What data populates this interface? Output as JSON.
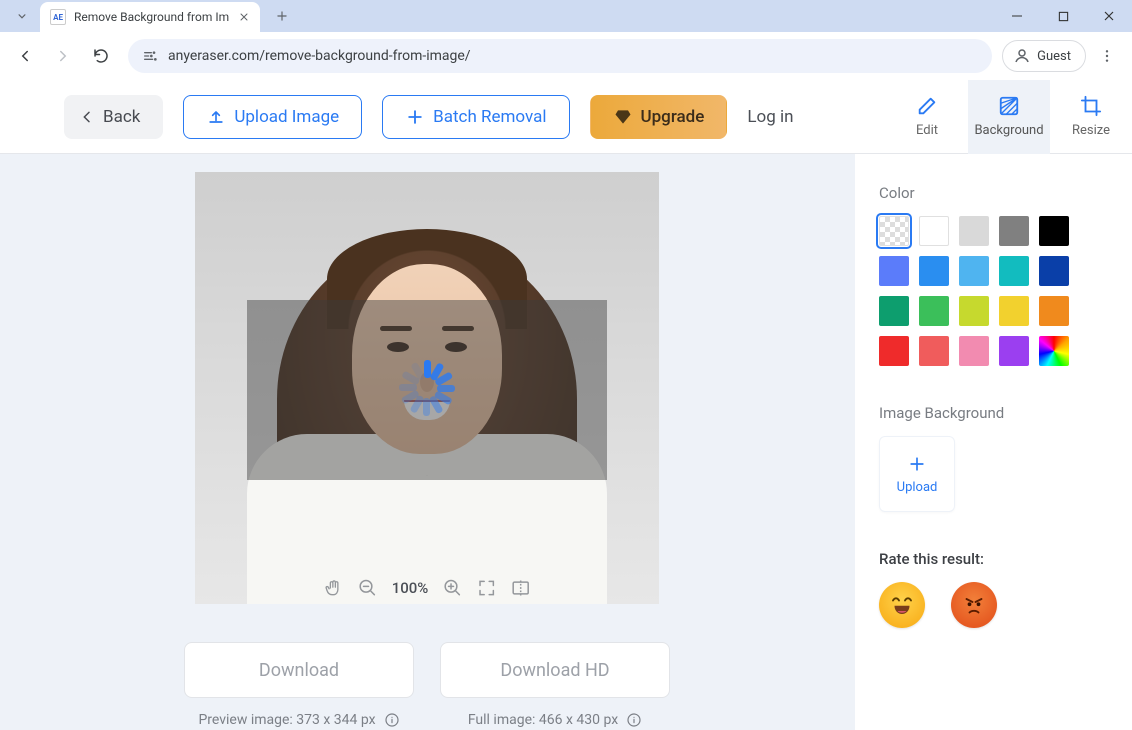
{
  "browser": {
    "tab_title": "Remove Background from Im",
    "url": "anyeraser.com/remove-background-from-image/",
    "guest_label": "Guest",
    "favicon_text": "AE"
  },
  "toolbar": {
    "back": "Back",
    "upload": "Upload Image",
    "batch": "Batch Removal",
    "upgrade": "Upgrade",
    "login": "Log in",
    "tabs": {
      "edit": "Edit",
      "background": "Background",
      "resize": "Resize"
    }
  },
  "canvas": {
    "zoom": "100%"
  },
  "downloads": {
    "preview_btn": "Download",
    "hd_btn": "Download HD",
    "preview_info": "Preview image: 373 x 344 px",
    "hd_info": "Full image: 466 x 430 px"
  },
  "panel": {
    "color_title": "Color",
    "colors": [
      {
        "id": "transparent",
        "css": "transparent",
        "selected": true
      },
      {
        "id": "white",
        "css": "#ffffff"
      },
      {
        "id": "light-gray",
        "css": "#d9d9d9"
      },
      {
        "id": "gray",
        "css": "#808080"
      },
      {
        "id": "black",
        "css": "#000000"
      },
      {
        "id": "blue",
        "css": "#5b7cfa"
      },
      {
        "id": "sky",
        "css": "#2a8ef0"
      },
      {
        "id": "light-blue",
        "css": "#4fb4f0"
      },
      {
        "id": "cyan",
        "css": "#12bcbf"
      },
      {
        "id": "navy",
        "css": "#0a3fa8"
      },
      {
        "id": "teal",
        "css": "#0d9e6e"
      },
      {
        "id": "green",
        "css": "#3bbf5a"
      },
      {
        "id": "lime",
        "css": "#c6d92e"
      },
      {
        "id": "yellow",
        "css": "#f2d12e"
      },
      {
        "id": "orange",
        "css": "#f08a1d"
      },
      {
        "id": "red",
        "css": "#ef2b2b"
      },
      {
        "id": "coral",
        "css": "#f05c5c"
      },
      {
        "id": "pink",
        "css": "#f28bb0"
      },
      {
        "id": "purple",
        "css": "#9b3ff0"
      },
      {
        "id": "rainbow",
        "css": "rainbow"
      }
    ],
    "image_bg_title": "Image Background",
    "upload_label": "Upload",
    "rate_title": "Rate this result:"
  }
}
